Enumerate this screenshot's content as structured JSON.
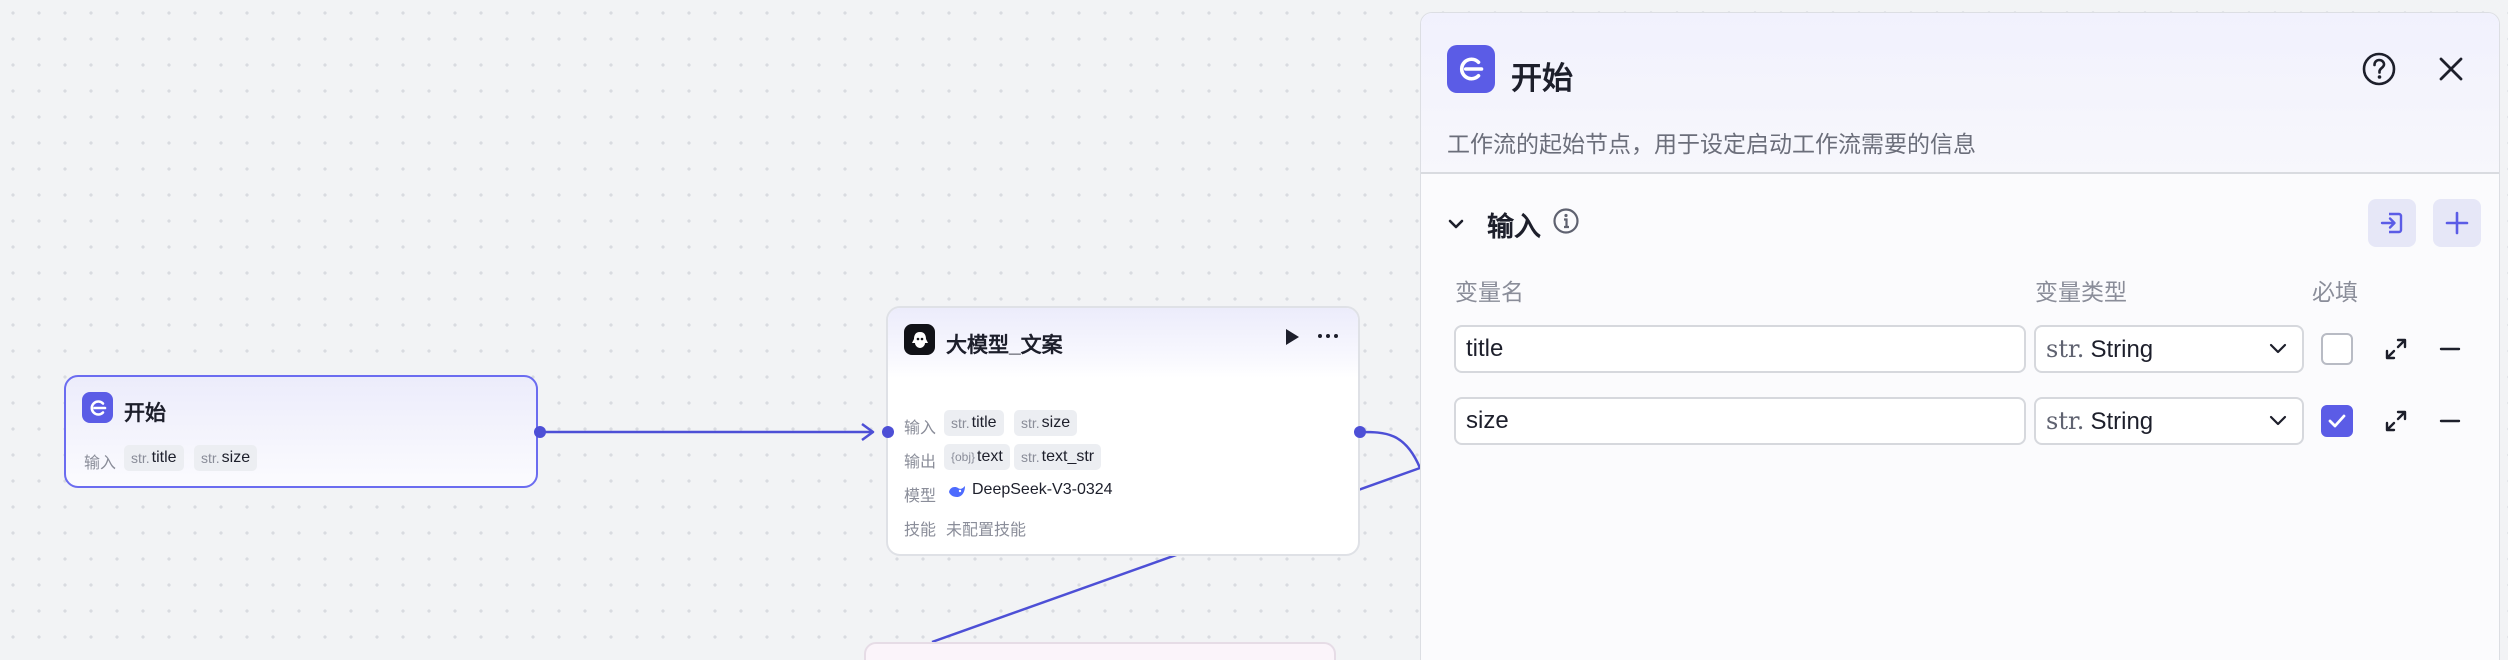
{
  "canvas": {
    "start_node": {
      "title": "开始",
      "input_label": "输入",
      "inputs": [
        {
          "type": "str.",
          "name": "title"
        },
        {
          "type": "str.",
          "name": "size"
        }
      ]
    },
    "llm_node": {
      "title": "大模型_文案",
      "input_label": "输入",
      "inputs": [
        {
          "type": "str.",
          "name": "title"
        },
        {
          "type": "str.",
          "name": "size"
        }
      ],
      "output_label": "输出",
      "outputs": [
        {
          "type": "{obj}",
          "name": "text"
        },
        {
          "type": "str.",
          "name": "text_str"
        }
      ],
      "model_label": "模型",
      "model_name": "DeepSeek-V3-0324",
      "skills_label": "技能",
      "skills_value": "未配置技能"
    }
  },
  "panel": {
    "title": "开始",
    "description": "工作流的起始节点，用于设定启动工作流需要的信息",
    "section_title": "输入",
    "columns": {
      "name": "变量名",
      "type": "变量类型",
      "required": "必填"
    },
    "rows": [
      {
        "name": "title",
        "type_prefix": "str.",
        "type": "String",
        "required": false
      },
      {
        "name": "size",
        "type_prefix": "str.",
        "type": "String",
        "required": true
      }
    ]
  },
  "colors": {
    "accent": "#5b5ce6",
    "edge": "#4d4fd6"
  }
}
